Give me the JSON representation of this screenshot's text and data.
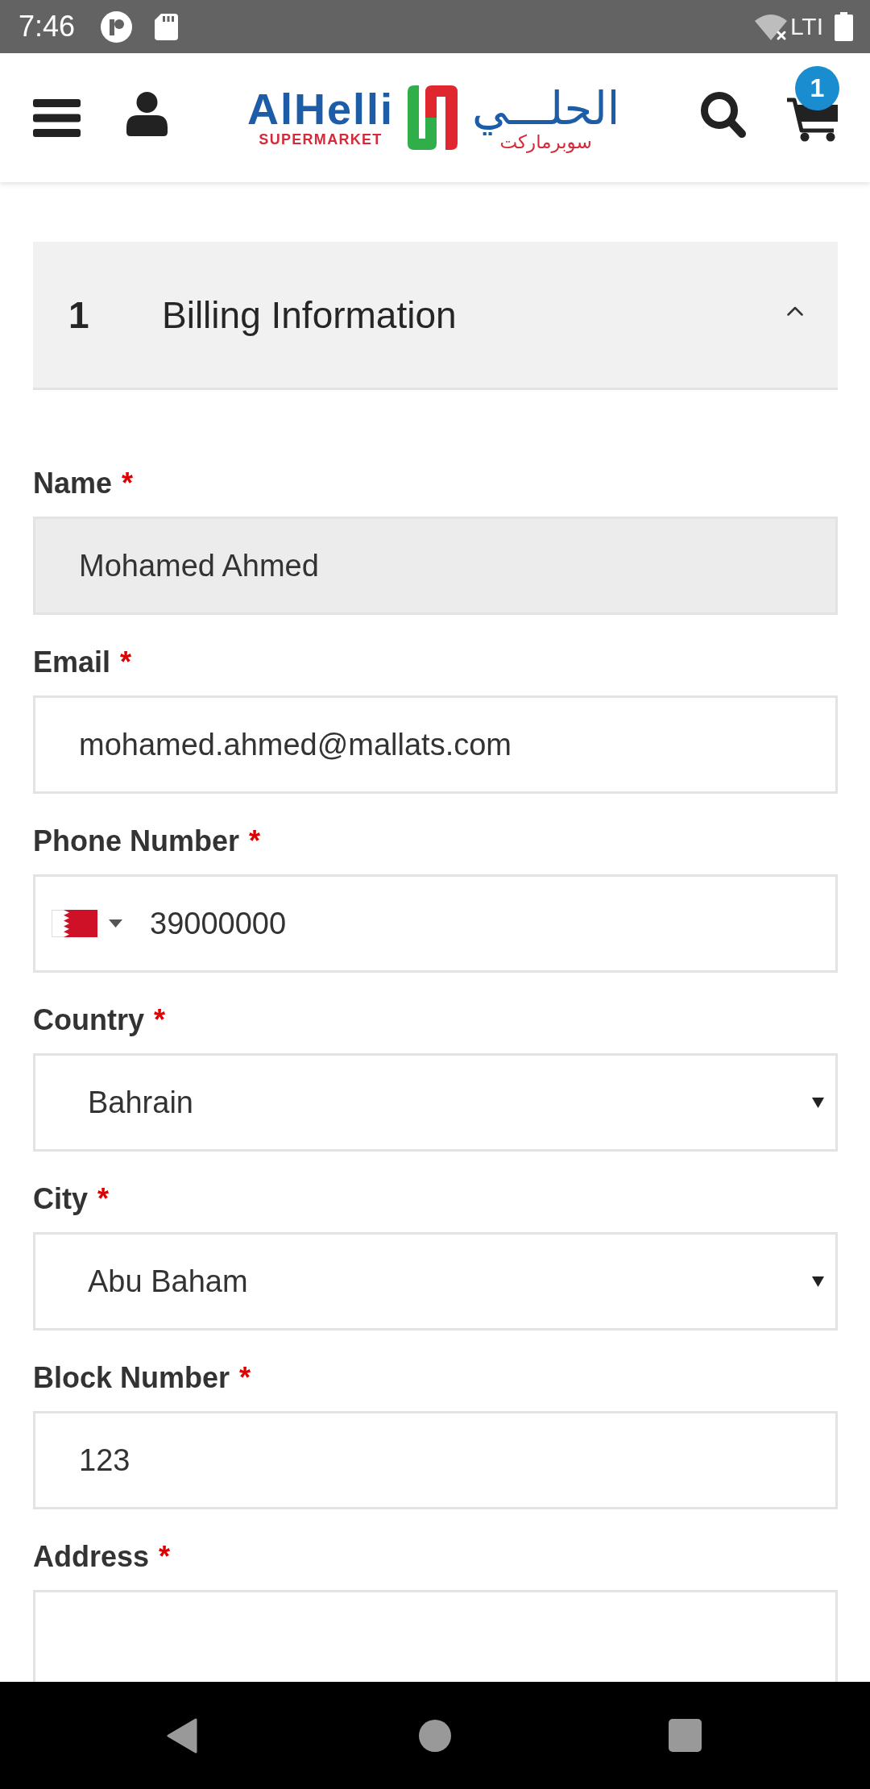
{
  "status_bar": {
    "time": "7:46",
    "network": "LTI"
  },
  "header": {
    "logo": {
      "latin_name": "AlHelli",
      "latin_tagline": "SUPERMARKET",
      "arabic_name": "الحلـــي",
      "arabic_tagline": "سوبرماركت"
    },
    "cart_count": "1"
  },
  "section": {
    "step": "1",
    "title": "Billing Information",
    "expanded": true
  },
  "fields": [
    {
      "kind": "text",
      "label": "Name",
      "required_mark": "*",
      "value": "Mohamed Ahmed",
      "readonly": true
    },
    {
      "kind": "text",
      "label": "Email",
      "required_mark": "*",
      "value": "mohamed.ahmed@mallats.com",
      "readonly": false
    },
    {
      "kind": "phone",
      "label": "Phone Number",
      "required_mark": "*",
      "value": "39000000",
      "readonly": false
    },
    {
      "kind": "select",
      "label": "Country",
      "required_mark": "*",
      "value": "Bahrain",
      "readonly": false
    },
    {
      "kind": "select",
      "label": "City",
      "required_mark": "*",
      "value": "Abu Baham",
      "readonly": false
    },
    {
      "kind": "text",
      "label": "Block Number",
      "required_mark": "*",
      "value": "123",
      "readonly": false
    },
    {
      "kind": "textarea",
      "label": "Address",
      "required_mark": "*",
      "readonly": false
    }
  ]
}
